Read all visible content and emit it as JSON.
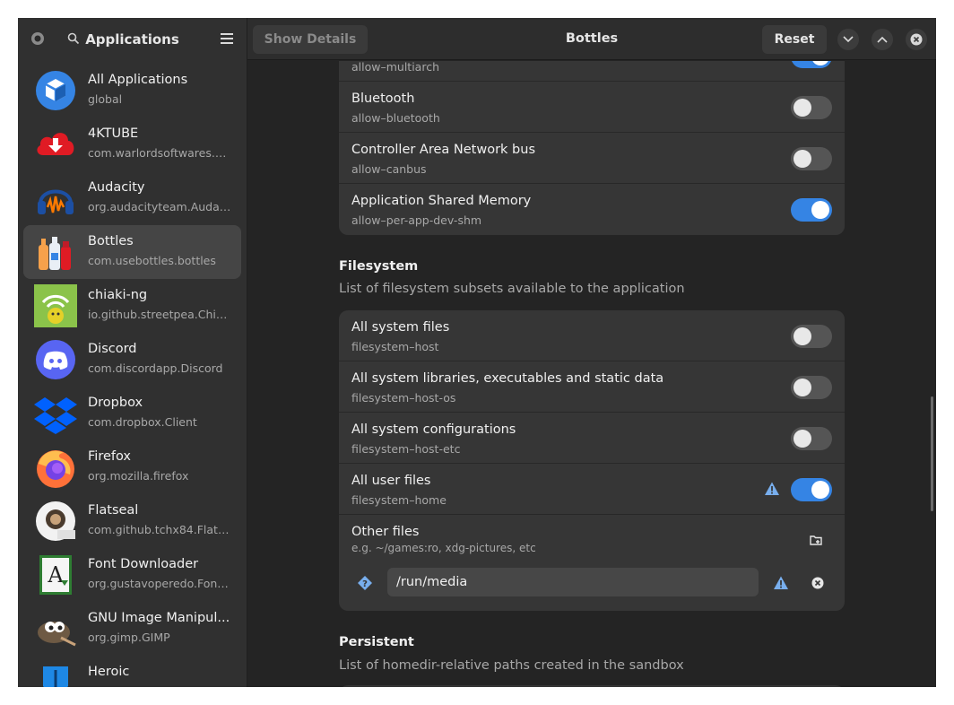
{
  "sidebar": {
    "title": "Applications",
    "apps": [
      {
        "name": "All Applications",
        "id": "global",
        "icon": "package-cube-icon"
      },
      {
        "name": "4KTUBE",
        "id": "com.warlordsoftwares.yo...",
        "icon": "cloud-download-icon"
      },
      {
        "name": "Audacity",
        "id": "org.audacityteam.Audacity",
        "icon": "audacity-icon"
      },
      {
        "name": "Bottles",
        "id": "com.usebottles.bottles",
        "icon": "bottles-icon"
      },
      {
        "name": "chiaki-ng",
        "id": "io.github.streetpea.Chiaki...",
        "icon": "chiaki-icon"
      },
      {
        "name": "Discord",
        "id": "com.discordapp.Discord",
        "icon": "discord-icon"
      },
      {
        "name": "Dropbox",
        "id": "com.dropbox.Client",
        "icon": "dropbox-icon"
      },
      {
        "name": "Firefox",
        "id": "org.mozilla.firefox",
        "icon": "firefox-icon"
      },
      {
        "name": "Flatseal",
        "id": "com.github.tchx84.Flatseal",
        "icon": "flatseal-icon"
      },
      {
        "name": "Font Downloader",
        "id": "org.gustavoperedo.FontD...",
        "icon": "font-downloader-icon"
      },
      {
        "name": "GNU Image Manipul...",
        "id": "org.gimp.GIMP",
        "icon": "gimp-icon"
      },
      {
        "name": "Heroic",
        "id": "",
        "icon": "heroic-icon"
      }
    ]
  },
  "header": {
    "show_details": "Show Details",
    "title": "Bottles",
    "reset": "Reset"
  },
  "devices": [
    {
      "sub": "allow–multiarch",
      "on": true
    },
    {
      "title": "Bluetooth",
      "sub": "allow–bluetooth",
      "on": false
    },
    {
      "title": "Controller Area Network bus",
      "sub": "allow–canbus",
      "on": false
    },
    {
      "title": "Application Shared Memory",
      "sub": "allow–per-app-dev-shm",
      "on": true
    }
  ],
  "filesystem": {
    "title": "Filesystem",
    "description": "List of filesystem subsets available to the application",
    "rows": [
      {
        "title": "All system files",
        "sub": "filesystem–host",
        "on": false
      },
      {
        "title": "All system libraries, executables and static data",
        "sub": "filesystem–host-os",
        "on": false
      },
      {
        "title": "All system configurations",
        "sub": "filesystem–host-etc",
        "on": false
      },
      {
        "title": "All user files",
        "sub": "filesystem–home",
        "on": true
      }
    ],
    "other": {
      "title": "Other files",
      "hint": "e.g. ~/games:ro, xdg-pictures, etc",
      "entry_value": "/run/media"
    }
  },
  "persistent": {
    "title": "Persistent",
    "description": "List of homedir-relative paths created in the sandbox"
  },
  "colors": {
    "accent": "#3584e4",
    "warning": "#78aeed"
  }
}
